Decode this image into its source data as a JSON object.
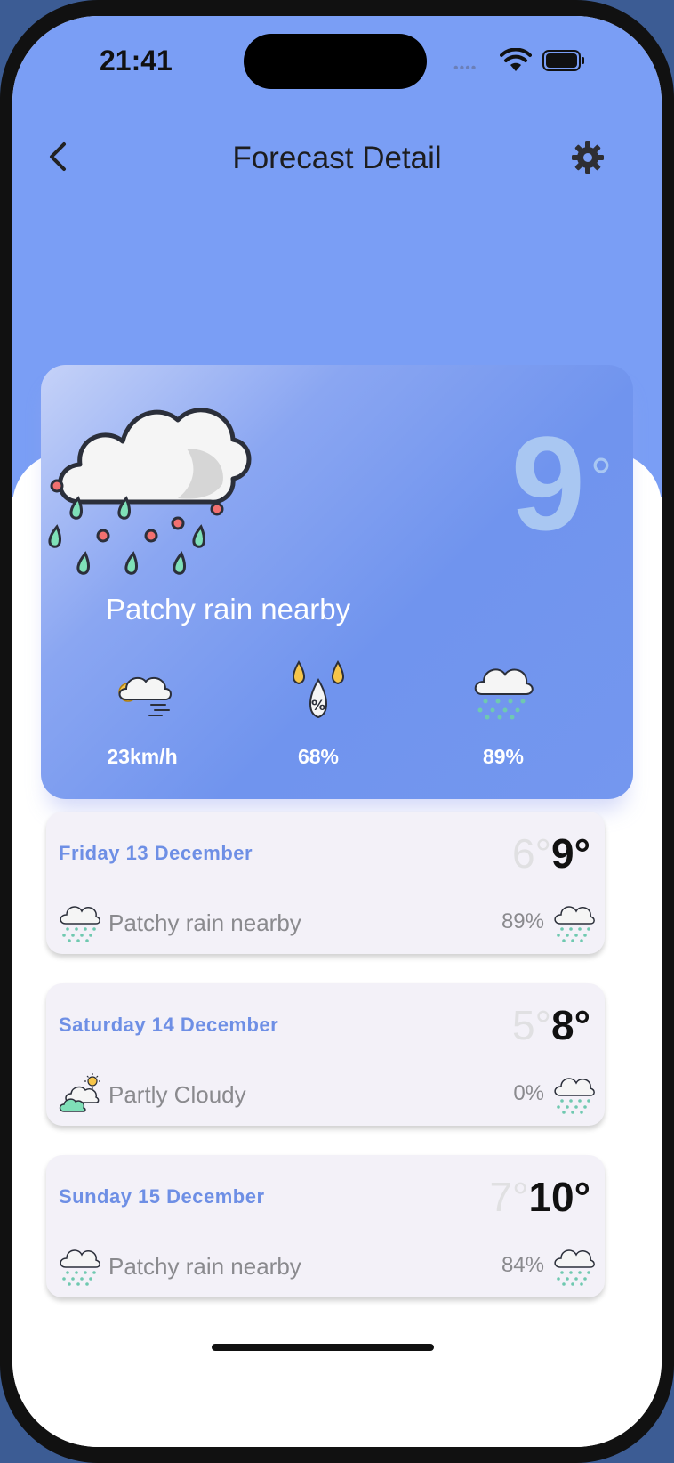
{
  "status_bar": {
    "time": "21:41",
    "signal": "••••",
    "wifi_icon": "wifi-icon",
    "battery_icon": "battery-icon"
  },
  "header": {
    "title": "Forecast Detail",
    "back_icon": "chevron-left-icon",
    "settings_icon": "gear-icon"
  },
  "current": {
    "temperature": "9",
    "degree": "°",
    "condition": "Patchy rain nearby",
    "icon": "rain-cloud-icon",
    "metrics": [
      {
        "name": "wind",
        "icon": "wind-cloud-icon",
        "value": "23km/h"
      },
      {
        "name": "humidity",
        "icon": "humidity-drops-icon",
        "value": "68%"
      },
      {
        "name": "precipitation",
        "icon": "rain-cloud-icon",
        "value": "89%"
      }
    ]
  },
  "forecast": [
    {
      "day": "Friday 13 December",
      "low": "6°",
      "high": "9°",
      "condition": "Patchy rain nearby",
      "icon": "rain-cloud-icon",
      "chance": "89%"
    },
    {
      "day": "Saturday 14 December",
      "low": "5°",
      "high": "8°",
      "condition": "Partly Cloudy",
      "icon": "partly-cloudy-icon",
      "chance": "0%"
    },
    {
      "day": "Sunday 15 December",
      "low": "7°",
      "high": "10°",
      "condition": "Patchy rain nearby",
      "icon": "rain-cloud-icon",
      "chance": "84%"
    }
  ],
  "colors": {
    "header_bg": "#7a9ef5",
    "accent": "#6e8fe5",
    "card_bg": "#f3f1f8"
  }
}
